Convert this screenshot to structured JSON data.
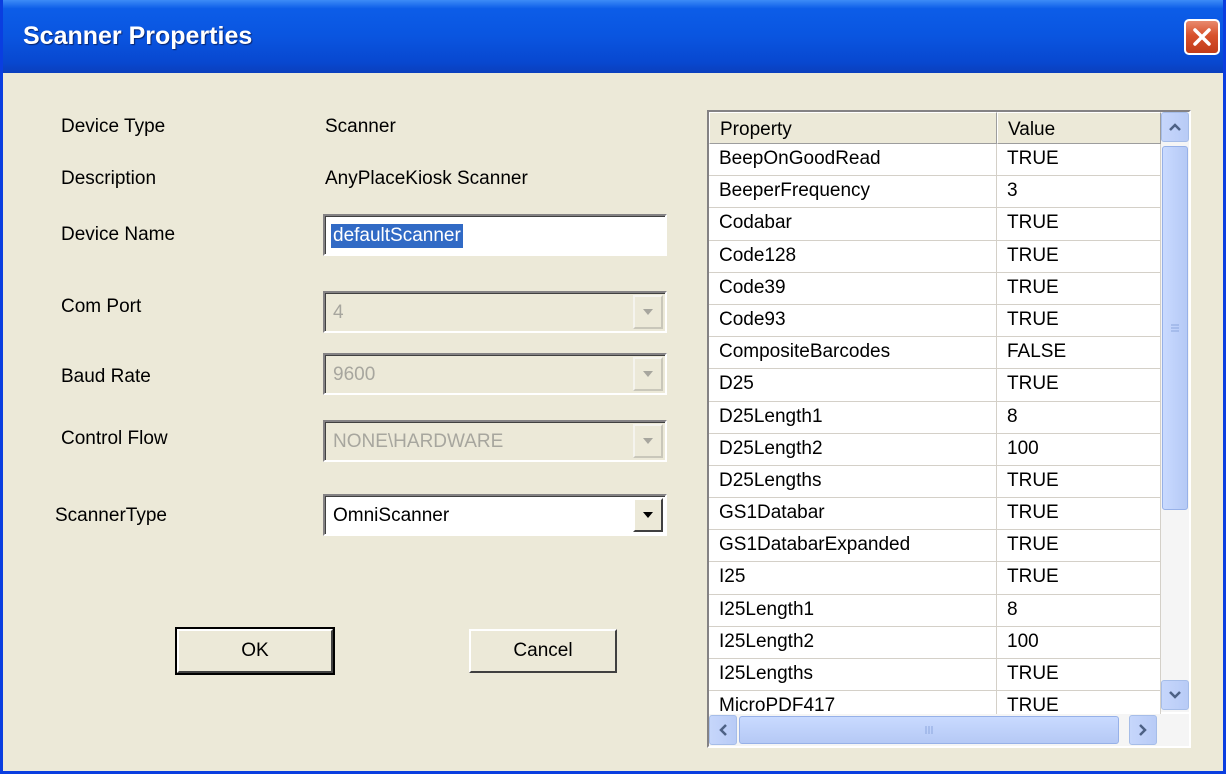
{
  "window": {
    "title": "Scanner Properties"
  },
  "fields": {
    "device_type_label": "Device Type",
    "device_type_value": "Scanner",
    "description_label": "Description",
    "description_value": "AnyPlaceKiosk Scanner",
    "device_name_label": "Device Name",
    "device_name_value": "defaultScanner",
    "com_port_label": "Com Port",
    "com_port_value": "4",
    "baud_rate_label": "Baud Rate",
    "baud_rate_value": "9600",
    "control_flow_label": "Control Flow",
    "control_flow_value": "NONE\\HARDWARE",
    "scanner_type_label": "ScannerType",
    "scanner_type_value": "OmniScanner"
  },
  "buttons": {
    "ok": "OK",
    "cancel": "Cancel"
  },
  "grid": {
    "headers": [
      "Property",
      "Value"
    ],
    "rows": [
      [
        "BeepOnGoodRead",
        "TRUE"
      ],
      [
        "BeeperFrequency",
        "3"
      ],
      [
        "Codabar",
        "TRUE"
      ],
      [
        "Code128",
        "TRUE"
      ],
      [
        "Code39",
        "TRUE"
      ],
      [
        "Code93",
        "TRUE"
      ],
      [
        "CompositeBarcodes",
        "FALSE"
      ],
      [
        "D25",
        "TRUE"
      ],
      [
        "D25Length1",
        "8"
      ],
      [
        "D25Length2",
        "100"
      ],
      [
        "D25Lengths",
        "TRUE"
      ],
      [
        "GS1Databar",
        "TRUE"
      ],
      [
        "GS1DatabarExpanded",
        "TRUE"
      ],
      [
        "I25",
        "TRUE"
      ],
      [
        "I25Length1",
        "8"
      ],
      [
        "I25Length2",
        "100"
      ],
      [
        "I25Lengths",
        "TRUE"
      ],
      [
        "MicroPDF417",
        "TRUE"
      ]
    ]
  },
  "colors": {
    "title_blue": "#0a55e0",
    "close_red": "#d8512b",
    "selection": "#316ac5",
    "dialog_bg": "#ece9d8"
  }
}
